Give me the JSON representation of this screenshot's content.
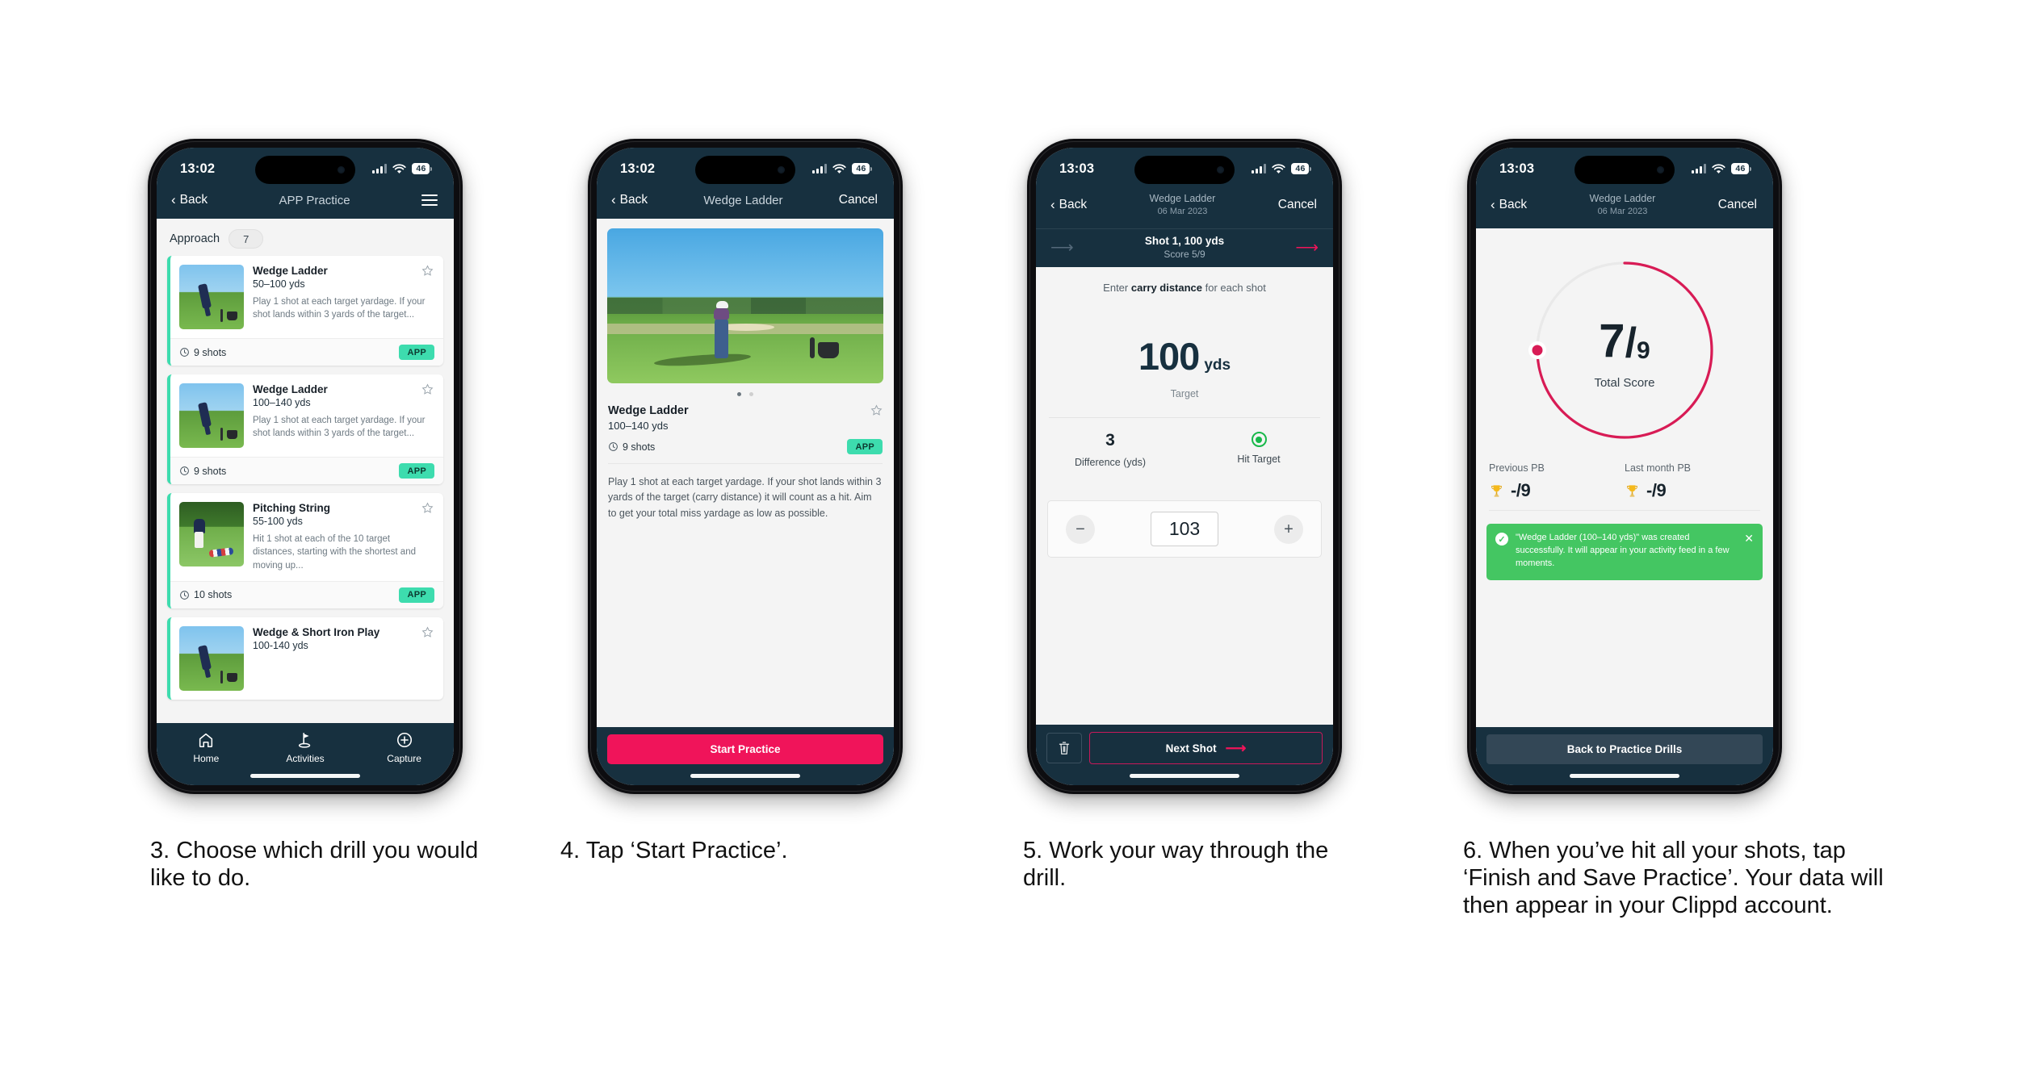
{
  "meta": {
    "accent_pink": "#f0145a",
    "navy": "#17303f",
    "mint": "#3ddcae",
    "green": "#44c662"
  },
  "phones": [
    {
      "status": {
        "time": "13:02",
        "battery": "46"
      },
      "nav": {
        "back": "Back",
        "title": "APP Practice",
        "menu_icon": "hamburger-menu-icon"
      },
      "section": {
        "label": "Approach",
        "count": "7"
      },
      "drills": [
        {
          "title": "Wedge Ladder",
          "range": "50–100 yds",
          "desc": "Play 1 shot at each target yardage. If your shot lands within 3 yards of the target...",
          "shots": "9 shots",
          "tag": "APP"
        },
        {
          "title": "Wedge Ladder",
          "range": "100–140 yds",
          "desc": "Play 1 shot at each target yardage. If your shot lands within 3 yards of the target...",
          "shots": "9 shots",
          "tag": "APP"
        },
        {
          "title": "Pitching String",
          "range": "55-100 yds",
          "desc": "Hit 1 shot at each of the 10 target distances, starting with the shortest and moving up...",
          "shots": "10 shots",
          "tag": "APP"
        },
        {
          "title": "Wedge & Short Iron Play",
          "range": "100-140 yds",
          "desc": "",
          "shots": "",
          "tag": ""
        }
      ],
      "tabs": [
        {
          "label": "Home",
          "icon": "home-icon"
        },
        {
          "label": "Activities",
          "icon": "golf-flag-icon"
        },
        {
          "label": "Capture",
          "icon": "plus-circle-icon"
        }
      ]
    },
    {
      "status": {
        "time": "13:02",
        "battery": "46"
      },
      "nav": {
        "back": "Back",
        "title": "Wedge Ladder",
        "cancel": "Cancel"
      },
      "detail": {
        "title": "Wedge Ladder",
        "range": "100–140 yds",
        "shots": "9 shots",
        "tag": "APP",
        "description": "Play 1 shot at each target yardage. If your shot lands within 3 yards of the target (carry distance) it will count as a hit. Aim to get your total miss yardage as low as possible.",
        "cta": "Start Practice"
      }
    },
    {
      "status": {
        "time": "13:03",
        "battery": "46"
      },
      "nav": {
        "back": "Back",
        "title": "Wedge Ladder",
        "date": "06 Mar 2023",
        "cancel": "Cancel"
      },
      "subnav": {
        "shot": "Shot 1, 100 yds",
        "score": "Score 5/9",
        "prev_icon": "arrow-left-icon",
        "next_icon": "arrow-right-icon"
      },
      "entry": {
        "prompt_pre": "Enter ",
        "prompt_bold": "carry distance",
        "prompt_post": " for each shot",
        "target_value": "100",
        "target_unit": "yds",
        "target_caption": "Target",
        "difference_value": "3",
        "difference_label": "Difference (yds)",
        "hit_label": "Hit Target",
        "stepper_minus": "−",
        "stepper_value": "103",
        "stepper_plus": "+",
        "delete_icon": "trash-icon",
        "next_button": "Next Shot"
      }
    },
    {
      "status": {
        "time": "13:03",
        "battery": "46"
      },
      "nav": {
        "back": "Back",
        "title": "Wedge Ladder",
        "date": "06 Mar 2023",
        "cancel": "Cancel"
      },
      "summary": {
        "score_num": "7",
        "score_den": "9",
        "score_label": "Total Score",
        "pbs": [
          {
            "label": "Previous PB",
            "value": "-/9",
            "icon": "trophy-icon"
          },
          {
            "label": "Last month PB",
            "value": "-/9",
            "icon": "trophy-icon"
          }
        ],
        "toast": {
          "icon": "check-circle-icon",
          "text": "\"Wedge Ladder (100–140 yds)\" was created successfully. It will appear in your activity feed in a few moments.",
          "close_icon": "close-icon"
        },
        "button": "Back to Practice Drills"
      }
    }
  ],
  "captions": [
    "3. Choose which drill you would like to do.",
    "4. Tap ‘Start Practice’.",
    "5. Work your way through the drill.",
    "6. When you’ve hit all your shots, tap ‘Finish and Save Practice’. Your data will then appear in your Clippd account."
  ]
}
